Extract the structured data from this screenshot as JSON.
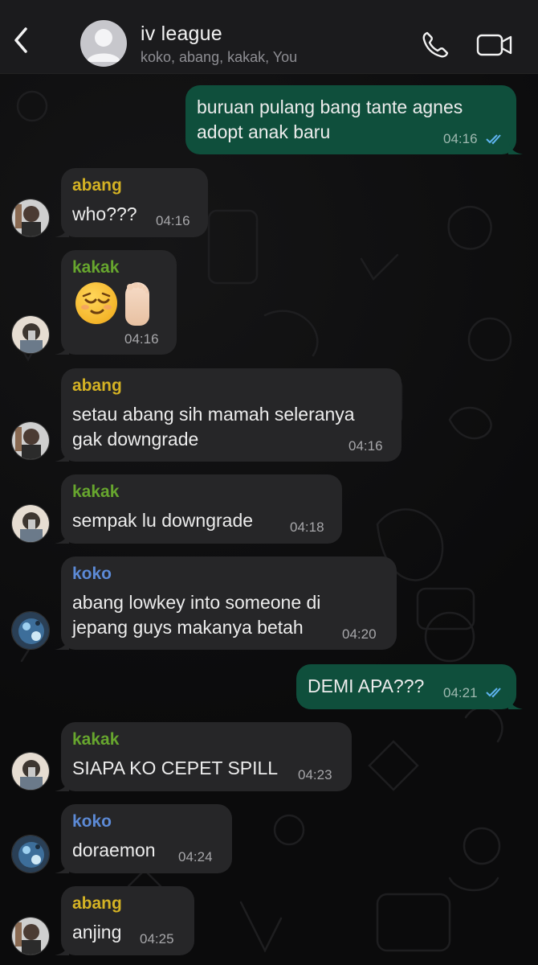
{
  "header": {
    "title": "iv league",
    "members": "koko, abang, kakak, You"
  },
  "colors": {
    "abang": "#d4b224",
    "kakak": "#67a62e",
    "koko": "#5c8ad6",
    "outgoing_bubble": "#0f4f3c",
    "incoming_bubble": "#262628",
    "read_ticks": "#5fb4f0"
  },
  "messages": [
    {
      "direction": "out",
      "line1": "buruan pulang bang tante agnes",
      "line2": "adopt anak baru",
      "time": "04:16",
      "status": "read"
    },
    {
      "direction": "in",
      "sender": "abang",
      "text": "who???",
      "time": "04:16"
    },
    {
      "direction": "in",
      "sender": "kakak",
      "emoji": [
        "relieved-face",
        "foot"
      ],
      "time": "04:16"
    },
    {
      "direction": "in",
      "sender": "abang",
      "line1": "setau abang sih mamah seleranya",
      "line2": "gak downgrade",
      "time": "04:16"
    },
    {
      "direction": "in",
      "sender": "kakak",
      "text": "sempak lu downgrade",
      "time": "04:18"
    },
    {
      "direction": "in",
      "sender": "koko",
      "line1": "abang lowkey into someone di",
      "line2": "jepang guys makanya betah",
      "time": "04:20"
    },
    {
      "direction": "out",
      "text": "DEMI APA???",
      "time": "04:21",
      "status": "read"
    },
    {
      "direction": "in",
      "sender": "kakak",
      "text": "SIAPA KO CEPET SPILL",
      "time": "04:23"
    },
    {
      "direction": "in",
      "sender": "koko",
      "text": "doraemon",
      "time": "04:24"
    },
    {
      "direction": "in",
      "sender": "abang",
      "text": "anjing",
      "time": "04:25"
    }
  ]
}
